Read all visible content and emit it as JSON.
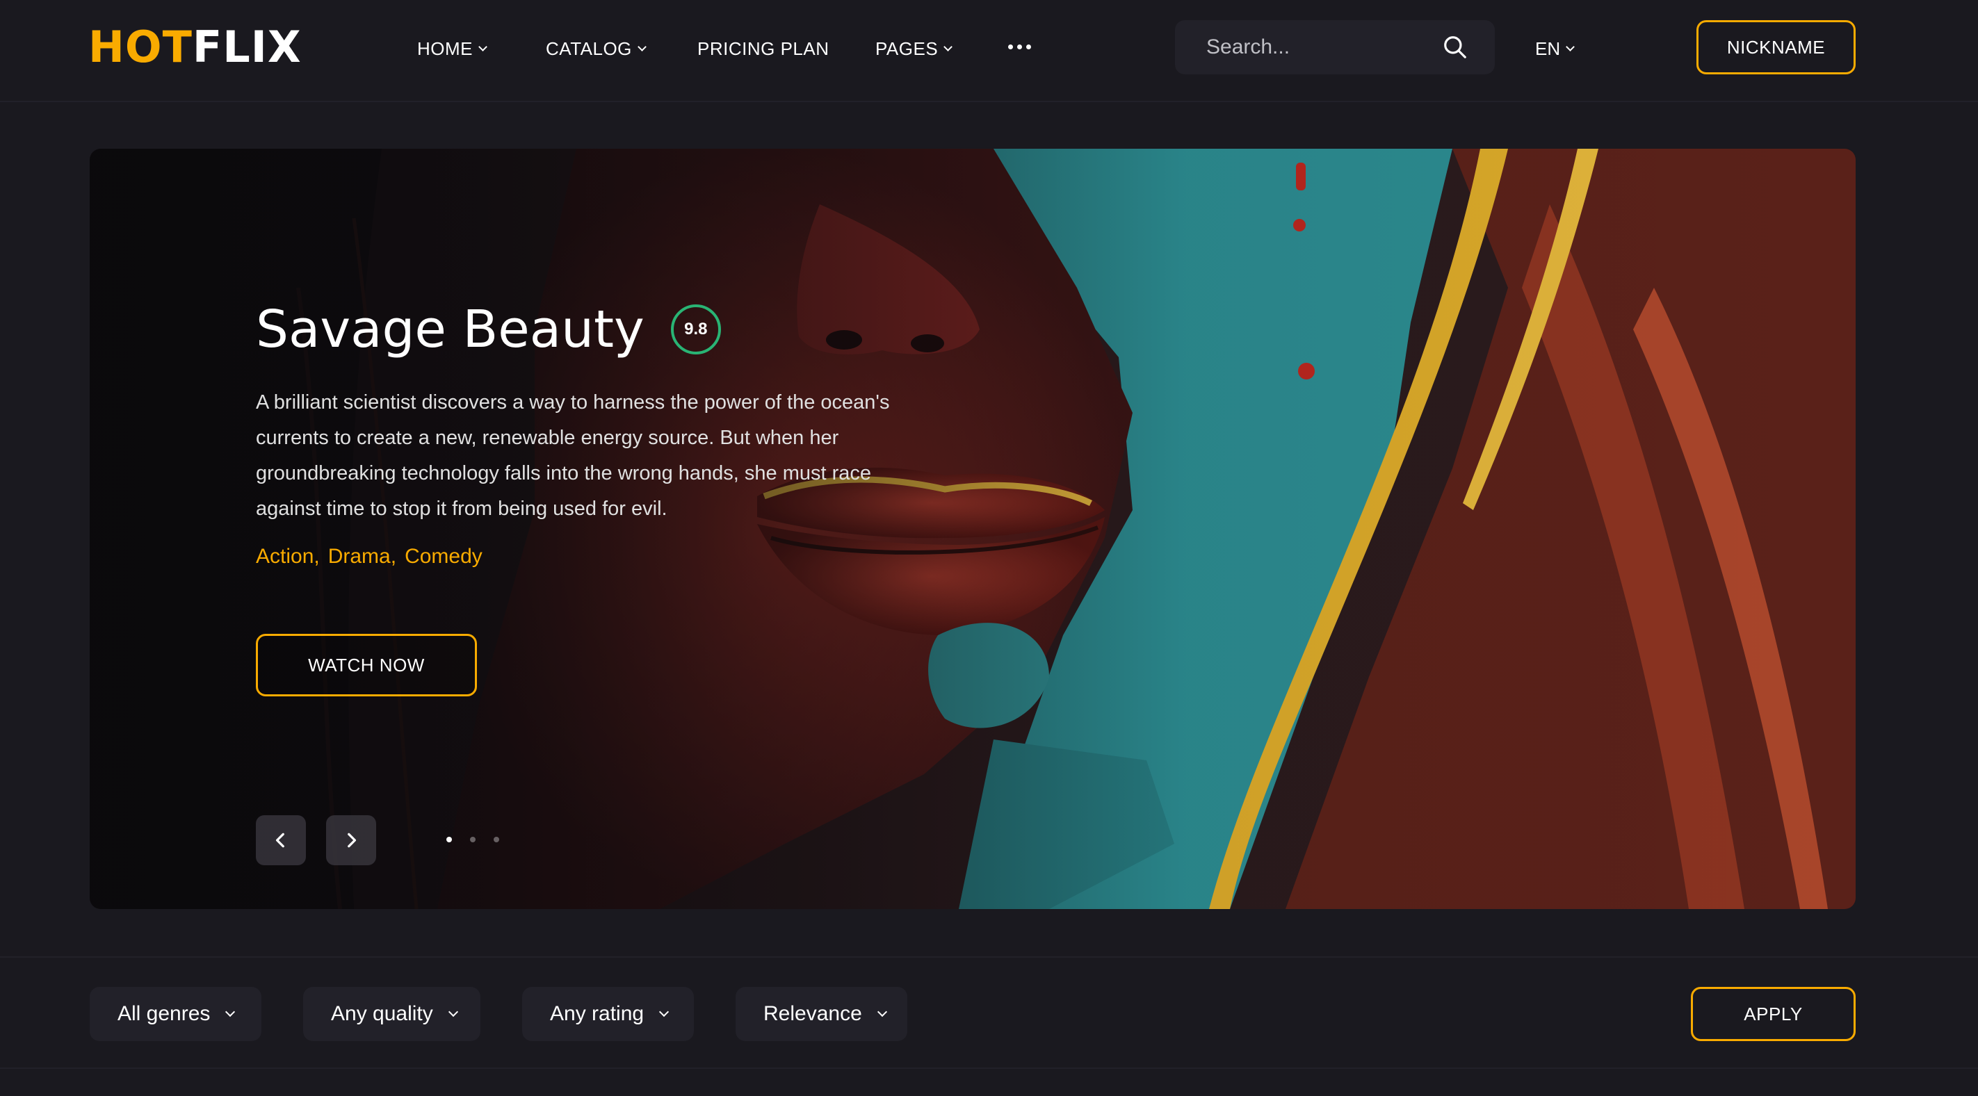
{
  "brand": {
    "logo_hot": "HOT",
    "logo_flix": "FLIX",
    "accent_color": "#f9ab00",
    "rating_color": "#29b474"
  },
  "nav": {
    "items": [
      {
        "label": "HOME",
        "has_dropdown": true
      },
      {
        "label": "CATALOG",
        "has_dropdown": true
      },
      {
        "label": "PRICING PLAN",
        "has_dropdown": false
      },
      {
        "label": "PAGES",
        "has_dropdown": true
      }
    ],
    "more_icon": "more-dots-icon"
  },
  "search": {
    "placeholder": "Search...",
    "icon": "search-icon"
  },
  "language": {
    "label": "EN"
  },
  "account": {
    "nickname_label": "NICKNAME"
  },
  "hero": {
    "title": "Savage Beauty",
    "rating": "9.8",
    "description": "A brilliant scientist discovers a way to harness the power of the ocean's currents to create a new, renewable energy source. But when her groundbreaking technology falls into the wrong hands, she must race against time to stop it from being used for evil.",
    "genres": [
      "Action,",
      "Drama,",
      "Comedy"
    ],
    "watch_label": "WATCH NOW",
    "prev_icon": "chevron-left-icon",
    "next_icon": "chevron-right-icon",
    "slide_count": 3,
    "active_slide": 1
  },
  "filters": {
    "genre": "All genres",
    "quality": "Any quality",
    "rating": "Any rating",
    "sort": "Relevance",
    "apply_label": "APPLY"
  }
}
